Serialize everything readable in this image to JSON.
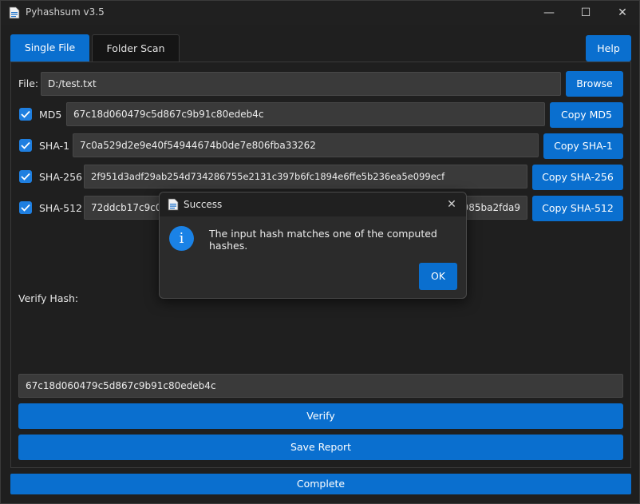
{
  "window": {
    "title": "Pyhashsum v3.5",
    "min_glyph": "—",
    "max_glyph": "☐",
    "close_glyph": "✕"
  },
  "tabs": [
    {
      "label": "Single File",
      "active": true
    },
    {
      "label": "Folder Scan",
      "active": false
    }
  ],
  "help_label": "Help",
  "file": {
    "label": "File:",
    "value": "D:/test.txt",
    "browse_label": "Browse"
  },
  "hashes": [
    {
      "name": "MD5",
      "checked": true,
      "value": "67c18d060479c5d867c9b91c80edeb4c",
      "copy_label": "Copy MD5"
    },
    {
      "name": "SHA-1",
      "checked": true,
      "value": "7c0a529d2e9e40f54944674b0de7e806fba33262",
      "copy_label": "Copy SHA-1"
    },
    {
      "name": "SHA-256",
      "checked": true,
      "value": "2f951d3adf29ab254d734286755e2131c397b6fc1894e6ffe5b236ea5e099ecf",
      "copy_label": "Copy SHA-256"
    },
    {
      "name": "SHA-512",
      "checked": true,
      "value_left": "72ddcb17c9c0a",
      "value_right": "985ba2fda9",
      "copy_label": "Copy SHA-512"
    }
  ],
  "verify": {
    "label": "Verify Hash:",
    "input_value": "67c18d060479c5d867c9b91c80edeb4c",
    "verify_label": "Verify",
    "save_label": "Save Report"
  },
  "status": "Complete",
  "dialog": {
    "title": "Success",
    "message": "The input hash matches one of the computed hashes.",
    "ok_label": "OK",
    "info_glyph": "i",
    "close_glyph": "✕"
  },
  "colors": {
    "accent": "#0a6fcf",
    "background": "#1f1f1f",
    "field": "#3a3a3a"
  }
}
